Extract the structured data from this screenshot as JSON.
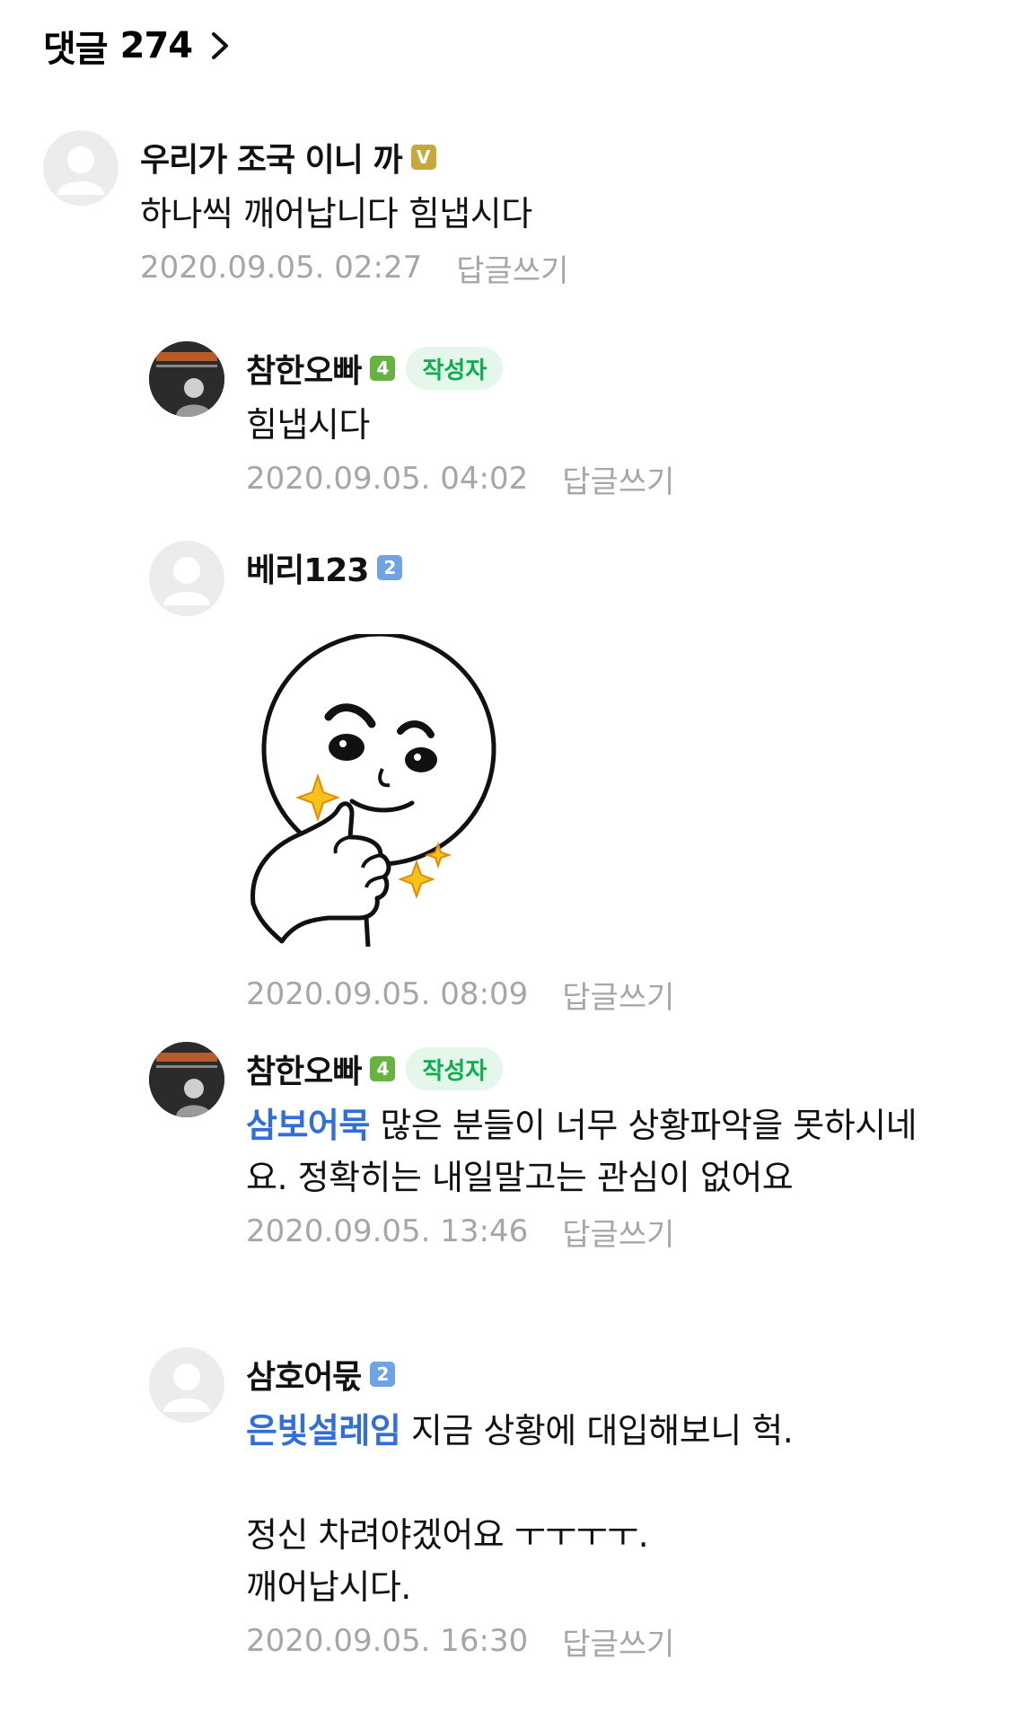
{
  "header": {
    "label": "댓글",
    "count": "274"
  },
  "comments": [
    {
      "nickname": "우리가 조국 이니 까",
      "badge": "V",
      "text": "하나씩 깨어납니다 힘냅시다",
      "date": "2020.09.05. 02:27",
      "reply": "답글쓰기"
    },
    {
      "nickname": "참한오빠",
      "badge": "4",
      "author_tag": "작성자",
      "text": "힘냅시다",
      "date": "2020.09.05. 04:02",
      "reply": "답글쓰기"
    },
    {
      "nickname": "베리123",
      "badge": "2",
      "sticker": "thumbs-up-moon-sticker",
      "date": "2020.09.05. 08:09",
      "reply": "답글쓰기"
    },
    {
      "nickname": "참한오빠",
      "badge": "4",
      "author_tag": "작성자",
      "mention": "삼보어묵",
      "text": " 많은 분들이 너무 상황파악을 못하시네요. 정확히는 내일말고는 관심이 없어요",
      "date": "2020.09.05. 13:46",
      "reply": "답글쓰기"
    },
    {
      "nickname": "삼호어묷",
      "badge": "2",
      "mention": "은빛설레임",
      "text": " 지금 상황에 대입해보니 헉.\n\n정신 차려야겠어요 ㅜㅜㅜㅜ.\n깨어납시다.",
      "date": "2020.09.05. 16:30",
      "reply": "답글쓰기"
    }
  ]
}
